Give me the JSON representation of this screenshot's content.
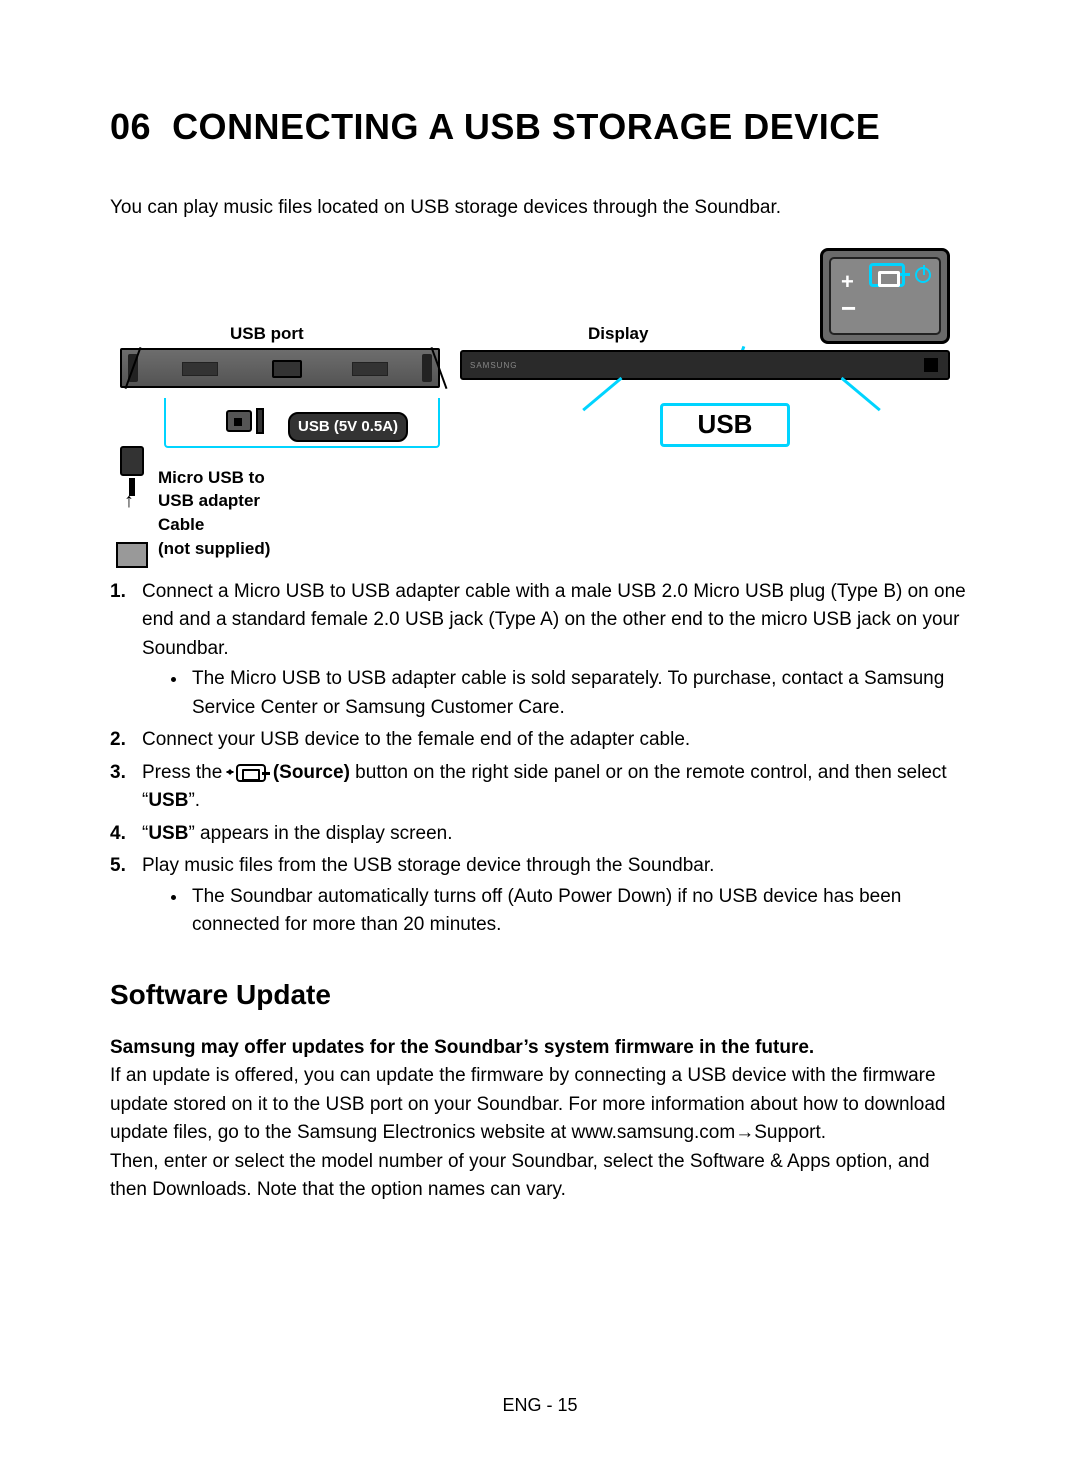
{
  "section_number": "06",
  "section_title": "CONNECTING A USB STORAGE DEVICE",
  "intro": "You can play music files located on USB storage devices through the Soundbar.",
  "figure": {
    "usb_port_label": "USB port",
    "display_label": "Display",
    "usb_badge": "USB (5V 0.5A)",
    "screen_text": "USB",
    "cable_label_line1": "Micro USB to",
    "cable_label_line2": "USB adapter Cable",
    "cable_label_line3": "(not supplied)"
  },
  "steps": {
    "s1": "Connect a Micro USB to USB adapter cable with a male USB 2.0 Micro USB plug (Type B) on one end and a standard female 2.0 USB jack (Type A) on the other end to the micro USB jack on your Soundbar.",
    "s1_bullet1": "The Micro USB to USB adapter cable is sold separately. To purchase, contact a Samsung Service Center or Samsung Customer Care.",
    "s2": "Connect your USB device to the female end of the adapter cable.",
    "s3_pre": "Press the ",
    "s3_source_label": "(Source)",
    "s3_post": " button on the right side panel or on the remote control, and then select ",
    "s3_usb_quote_open": "“",
    "s3_usb": "USB",
    "s3_usb_quote_close": "”.",
    "s4_quote_open": "“",
    "s4_usb": "USB",
    "s4_rest": "” appears in the display screen.",
    "s5": "Play music files from the USB storage device through the Soundbar.",
    "s5_bullet1": "The Soundbar automatically turns off (Auto Power Down) if no USB device has been connected for more than 20 minutes."
  },
  "software_update": {
    "title": "Software Update",
    "lead": "Samsung may offer updates for the Soundbar’s system firmware in the future.",
    "p1": "If an update is offered, you can update the firmware by connecting a USB device with the firmware update stored on it to the USB port on your Soundbar. For more information about how to download update files, go to the Samsung Electronics website at www.samsung.com→Support.",
    "p2": "Then, enter or select the model number of your Soundbar, select the Software & Apps option, and then Downloads. Note that the option names can vary."
  },
  "footer": "ENG - 15"
}
